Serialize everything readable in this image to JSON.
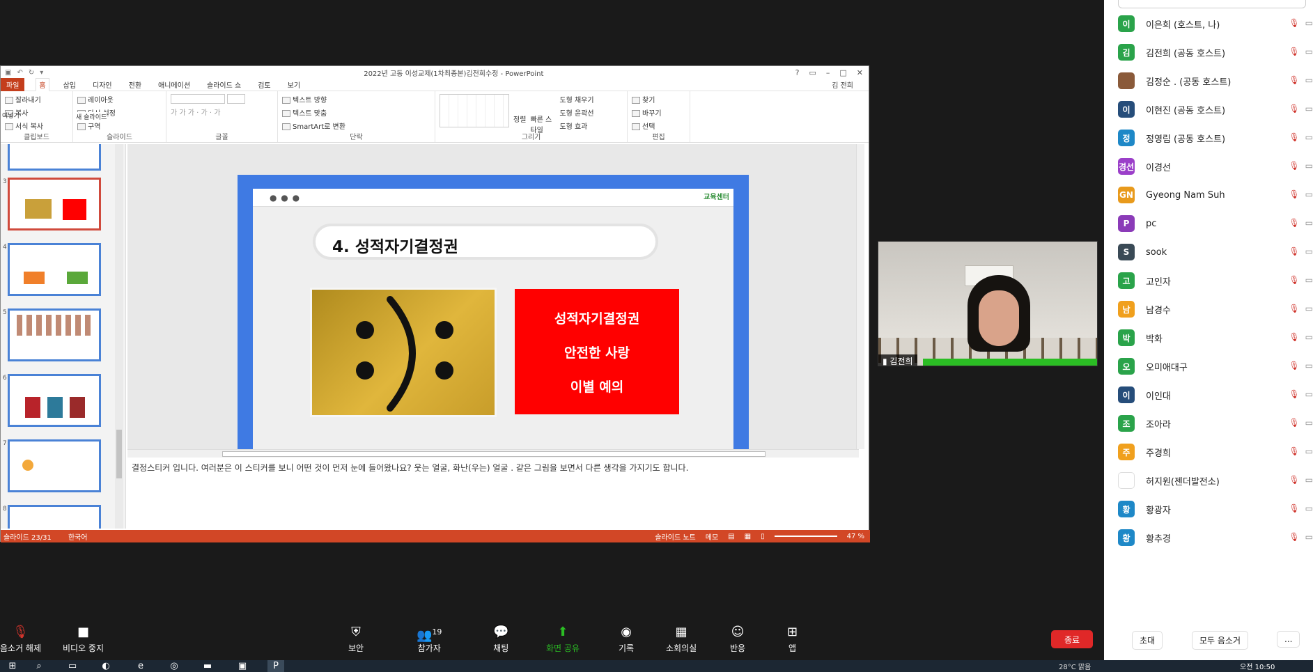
{
  "ppt": {
    "title": "2022년 고동 이성교제(1차최종본)김전희수정 - PowerPoint",
    "user": "김 전희",
    "tabs": [
      {
        "label": "파일"
      },
      {
        "label": "홈"
      },
      {
        "label": "삽입"
      },
      {
        "label": "디자인"
      },
      {
        "label": "전환"
      },
      {
        "label": "애니메이션"
      },
      {
        "label": "슬라이드 쇼"
      },
      {
        "label": "검토"
      },
      {
        "label": "보기"
      }
    ],
    "ribbon": {
      "clipboard": {
        "paste": "여넣기",
        "cut": "잘라내기",
        "copy": "복사",
        "format_copy": "서식 복사",
        "label": "클립보드"
      },
      "slides": {
        "new_slide": "새 슬라이드",
        "layout": "레이아웃",
        "reset": "다시 설정",
        "section": "구역",
        "label": "슬라이드"
      },
      "font": {
        "label": "글꼴"
      },
      "paragraph": {
        "text_direction": "텍스트 방향",
        "text_align": "텍스트 맞춤",
        "smartart": "SmartArt로 변환",
        "label": "단락"
      },
      "drawing": {
        "arrange": "정렬",
        "quick_styles": "빠른 스타일",
        "fill": "도형 채우기",
        "outline": "도형 윤곽선",
        "effects": "도형 효과",
        "label": "그리기"
      },
      "editing": {
        "find": "찾기",
        "replace": "바꾸기",
        "select": "선택",
        "label": "편집"
      }
    },
    "thumbnails": [
      {
        "num": ""
      },
      {
        "num": "3"
      },
      {
        "num": "4"
      },
      {
        "num": "5"
      },
      {
        "num": "6"
      },
      {
        "num": "7"
      },
      {
        "num": "8"
      }
    ],
    "slide": {
      "heading": "4. 성적자기결정권",
      "logo": "교육센터",
      "red_lines": [
        "성적자기결정권",
        "안전한 사랑",
        "이별 예의"
      ]
    },
    "notes": "결정스티커 입니다. 여러분은 이 스티커를 보니 어떤 것이 먼저 눈에 들어왔나요? 웃는 얼굴, 화난(우는) 얼굴 . 같은 그림을 보면서 다른 생각을 가지기도 합니다.",
    "status": {
      "slide": "슬라이드 23/31",
      "lang": "한국어",
      "notes_btn": "슬라이드 노트",
      "memo": "메모",
      "zoom": "47 %"
    }
  },
  "video": {
    "name": "김전희"
  },
  "participants": [
    {
      "initial": "이",
      "name": "이은희 (호스트, 나)",
      "color": "#2aa34a"
    },
    {
      "initial": "김",
      "name": "김전희 (공동 호스트)",
      "color": "#2aa34a"
    },
    {
      "initial": "",
      "name": "김정순 . (공동 호스트)",
      "color": "#8a5a3a"
    },
    {
      "initial": "이",
      "name": "이현진 (공동 호스트)",
      "color": "#264d7a"
    },
    {
      "initial": "정",
      "name": "정영림 (공동 호스트)",
      "color": "#1e88c7"
    },
    {
      "initial": "경선",
      "name": "이경선",
      "color": "#9b3fc9"
    },
    {
      "initial": "GN",
      "name": "Gyeong Nam Suh",
      "color": "#e89a1c"
    },
    {
      "initial": "P",
      "name": "pc",
      "color": "#8b3bb8"
    },
    {
      "initial": "S",
      "name": "sook",
      "color": "#3a4a56"
    },
    {
      "initial": "고",
      "name": "고인자",
      "color": "#2aa34a"
    },
    {
      "initial": "남",
      "name": "남경수",
      "color": "#f0a01e"
    },
    {
      "initial": "박",
      "name": "박화",
      "color": "#2aa34a"
    },
    {
      "initial": "오",
      "name": "오미애대구",
      "color": "#2aa34a"
    },
    {
      "initial": "이",
      "name": "이인대",
      "color": "#264d7a"
    },
    {
      "initial": "조",
      "name": "조아라",
      "color": "#2aa34a"
    },
    {
      "initial": "주",
      "name": "주경희",
      "color": "#f0a01e"
    },
    {
      "initial": "",
      "name": "허지원(젠더발전소)",
      "color": "#ffffff"
    },
    {
      "initial": "황",
      "name": "황광자",
      "color": "#1e88c7"
    },
    {
      "initial": "황",
      "name": "황추경",
      "color": "#1e88c7"
    }
  ],
  "panel": {
    "invite": "초대",
    "mute_all": "모두 음소거",
    "more": "..."
  },
  "toolbar": {
    "unmute": "음소거 해제",
    "video": "비디오 중지",
    "security": "보안",
    "participants": "참가자",
    "participants_count": "19",
    "chat": "채팅",
    "share": "화면 공유",
    "record": "기록",
    "breakout": "소회의실",
    "reactions": "반응",
    "apps": "앱",
    "end": "종료"
  },
  "taskbar": {
    "time": "오전 10:50",
    "weather": "28°C 맑음"
  }
}
